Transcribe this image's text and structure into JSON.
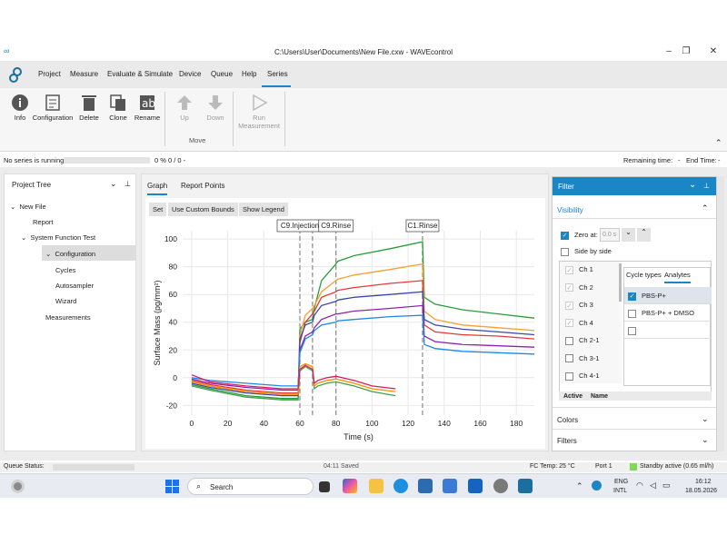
{
  "window": {
    "title": "C:\\Users\\User\\Documents\\New File.cxw - WAVEcontrol"
  },
  "menu": [
    "Project",
    "Measure",
    "Evaluate & Simulate",
    "Device",
    "Queue",
    "Help",
    "Series"
  ],
  "ribbon": {
    "buttons": [
      "Info",
      "Configuration",
      "Delete",
      "Clone",
      "Rename"
    ],
    "move": {
      "up": "Up",
      "down": "Down",
      "group": "Move"
    },
    "run": "Run Measurement"
  },
  "status": {
    "left": "No series is running",
    "progress": "0 %  0  /  0  -",
    "remaining": "Remaining time:",
    "remaining_value": "-",
    "end": "End Time:",
    "end_value": "-"
  },
  "project_tree": {
    "title": "Project Tree",
    "items": [
      "New File",
      "Report",
      "System Function Test",
      "Configuration",
      "Cycles",
      "Autosampler",
      "Wizard",
      "Measurements"
    ]
  },
  "graph": {
    "tabs": [
      "Graph",
      "Report Points"
    ],
    "toolbar": [
      "Set",
      "Use Custom Bounds",
      "Show Legend"
    ],
    "markers": [
      "C9.Injection",
      "C9.Rinse",
      "C1.Rinse"
    ]
  },
  "filter": {
    "title": "Filter",
    "visibility": "Visibility",
    "zero_at_label": "Zero at:",
    "zero_at_value": "0.0 s",
    "side_by_side": "Side by side",
    "channels": [
      {
        "label": "Ch 1",
        "checked": true
      },
      {
        "label": "Ch 2",
        "checked": true
      },
      {
        "label": "Ch 3",
        "checked": true
      },
      {
        "label": "Ch 4",
        "checked": true
      },
      {
        "label": "Ch 2-1",
        "checked": false
      },
      {
        "label": "Ch 3-1",
        "checked": false
      },
      {
        "label": "Ch 4-1",
        "checked": false
      }
    ],
    "tabs": [
      "Cycle types",
      "Analytes"
    ],
    "analytes": [
      {
        "label": "PBS-P+",
        "checked": true
      },
      {
        "label": "PBS-P+ + DMSO",
        "checked": false
      },
      {
        "label": "",
        "checked": false
      }
    ],
    "columns": [
      "Active",
      "Name"
    ],
    "colors": "Colors",
    "filters": "Filters"
  },
  "queue": {
    "label": "Queue Status:",
    "saved": "04:11  Saved",
    "fc_temp": "FC Temp: 25 °C",
    "port": "Port 1",
    "standby": "Standby active (0.65 ml/h)"
  },
  "taskbar": {
    "search": "Search",
    "lang1": "ENG",
    "lang2": "INTL",
    "time": "16:12",
    "date": "18.05.2026"
  },
  "chart_data": {
    "type": "line",
    "xlabel": "Time (s)",
    "ylabel": "Surface Mass (pg/mm²)",
    "xlim": [
      -5,
      190
    ],
    "ylim": [
      -27,
      106
    ],
    "xticks": [
      0,
      20,
      40,
      60,
      80,
      100,
      120,
      140,
      160,
      180
    ],
    "yticks": [
      -20,
      0,
      20,
      40,
      60,
      80,
      100
    ],
    "grid": true,
    "markers_x": [
      60,
      67,
      80,
      128
    ],
    "series": [
      {
        "color": "#2a9d3a",
        "x": [
          0,
          10,
          30,
          50,
          59,
          60,
          63,
          67,
          68,
          72,
          80,
          81,
          90,
          110,
          128,
          129,
          135,
          150,
          170,
          190
        ],
        "y": [
          -5,
          -8,
          -13,
          -15,
          -15,
          35,
          40,
          42,
          50,
          70,
          82,
          84,
          88,
          93,
          98,
          58,
          53,
          49,
          46,
          43
        ]
      },
      {
        "color": "#f5a030",
        "x": [
          0,
          10,
          30,
          50,
          59,
          60,
          63,
          67,
          68,
          72,
          80,
          81,
          90,
          110,
          128,
          129,
          135,
          150,
          170,
          190
        ],
        "y": [
          -3,
          -6,
          -10,
          -12,
          -12,
          30,
          45,
          50,
          52,
          62,
          70,
          71,
          74,
          78,
          82,
          48,
          42,
          38,
          36,
          34
        ]
      },
      {
        "color": "#e53935",
        "x": [
          0,
          10,
          30,
          50,
          59,
          60,
          63,
          67,
          68,
          72,
          80,
          81,
          90,
          110,
          128,
          129,
          135,
          150,
          170,
          190
        ],
        "y": [
          -2,
          -5,
          -9,
          -11,
          -11,
          25,
          40,
          46,
          48,
          58,
          62,
          63,
          65,
          68,
          70,
          38,
          33,
          31,
          30,
          28
        ]
      },
      {
        "color": "#3949ab",
        "x": [
          0,
          10,
          30,
          50,
          59,
          60,
          63,
          67,
          68,
          72,
          80,
          81,
          90,
          110,
          128,
          129,
          135,
          150,
          170,
          190
        ],
        "y": [
          -4,
          -7,
          -11,
          -13,
          -13,
          28,
          38,
          40,
          45,
          52,
          55,
          56,
          58,
          60,
          62,
          42,
          38,
          35,
          33,
          31
        ]
      },
      {
        "color": "#8e24aa",
        "x": [
          0,
          10,
          30,
          50,
          59,
          60,
          63,
          67,
          68,
          72,
          80,
          81,
          90,
          110,
          128,
          129,
          135,
          150,
          170,
          190
        ],
        "y": [
          -1,
          -4,
          -7,
          -9,
          -9,
          20,
          30,
          33,
          36,
          42,
          46,
          46,
          48,
          50,
          52,
          30,
          26,
          24,
          23,
          22
        ]
      },
      {
        "color": "#1e88e5",
        "x": [
          0,
          10,
          30,
          50,
          59,
          60,
          63,
          67,
          68,
          72,
          80,
          81,
          90,
          110,
          128,
          129,
          135,
          150,
          170,
          190
        ],
        "y": [
          0,
          -2,
          -4,
          -6,
          -6,
          18,
          28,
          31,
          34,
          38,
          40,
          41,
          42,
          44,
          45,
          24,
          21,
          19,
          18,
          17
        ]
      },
      {
        "color": "#43a047",
        "x": [
          0,
          10,
          30,
          50,
          59,
          60,
          63,
          67,
          68,
          70,
          75,
          80,
          90,
          100,
          113
        ],
        "y": [
          -6,
          -9,
          -14,
          -16,
          -16,
          5,
          8,
          5,
          -8,
          -6,
          -4,
          -3,
          -6,
          -10,
          -13
        ]
      },
      {
        "color": "#fb8c00",
        "x": [
          0,
          10,
          30,
          50,
          59,
          60,
          63,
          67,
          68,
          70,
          75,
          80,
          90,
          100,
          113
        ],
        "y": [
          -3,
          -6,
          -10,
          -12,
          -12,
          8,
          10,
          8,
          -6,
          -4,
          -2,
          -1,
          -4,
          -8,
          -10
        ]
      },
      {
        "color": "#d81b60",
        "x": [
          0,
          10,
          30,
          50,
          59,
          60,
          63,
          67,
          68,
          70,
          75,
          80,
          90,
          100,
          113
        ],
        "y": [
          2,
          -3,
          -6,
          -8,
          -8,
          6,
          9,
          6,
          -4,
          -2,
          0,
          1,
          -2,
          -6,
          -8
        ]
      }
    ]
  }
}
